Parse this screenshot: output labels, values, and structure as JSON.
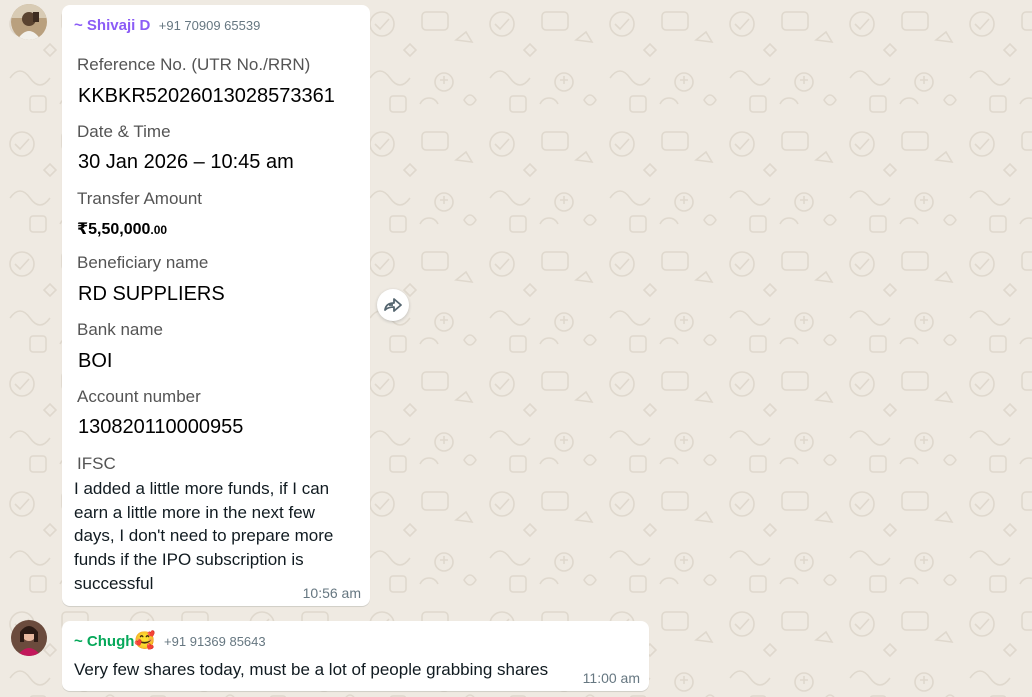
{
  "colors": {
    "chat_background": "#efeae2",
    "bubble_background": "#ffffff",
    "sender1_name_color": "#8b5cf6",
    "sender2_name_color": "#06a85a",
    "timestamp_color": "#667781"
  },
  "messages": [
    {
      "sender_name": "~ Shivaji D",
      "sender_phone": "+91 70909 65539",
      "avatar_icon": "profile-photo",
      "receipt": {
        "reference_label": "Reference No. (UTR No./RRN)",
        "reference_value": "KKBKR52026013028573361",
        "datetime_label": "Date & Time",
        "datetime_value": "30 Jan 2026 – 10:45 am",
        "amount_label": "Transfer Amount",
        "amount_main": "₹5,50,000",
        "amount_paise": ".00",
        "beneficiary_label": "Beneficiary name",
        "beneficiary_value": "RD SUPPLIERS",
        "bank_label": "Bank name",
        "bank_value": "BOI",
        "account_label": "Account number",
        "account_value": "130820110000955",
        "ifsc_label": "IFSC"
      },
      "caption_lines": [
        "I added a little more funds, if I can",
        "earn a little more in the next few",
        "days, I don't need to prepare more",
        "funds if the IPO subscription is",
        "successful"
      ],
      "time": "10:56 am",
      "forward_icon": "forward-icon"
    },
    {
      "sender_name": "~ Chugh",
      "sender_emoji": "🥰",
      "sender_phone": "+91 91369 85643",
      "avatar_icon": "profile-photo",
      "text": "Very few shares today, must be a lot of people grabbing shares",
      "time": "11:00 am"
    }
  ]
}
